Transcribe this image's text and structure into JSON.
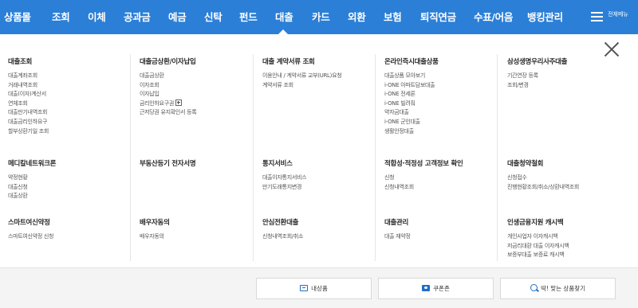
{
  "topnav": {
    "items": [
      "상품몰",
      "조회",
      "이체",
      "공과금",
      "예금",
      "신탁",
      "펀드",
      "대출",
      "카드",
      "외환",
      "보험",
      "퇴직연금",
      "수표/어음",
      "뱅킹관리"
    ],
    "active_index": 7,
    "menu_label": "전체메뉴",
    "color": "#2b7fd7"
  },
  "sections": [
    {
      "title": "대출조회",
      "items": [
        "대출계좌조회",
        "거래내역조회",
        "대출(이자)계산서",
        "연체조회",
        "대출만기내역조회",
        "대출금리인하요구",
        "할부상환기일 조회"
      ]
    },
    {
      "title": "대출금상환/이자납입",
      "items": [
        "대출금상환",
        "이자조회",
        "이자납입",
        "금리인하요구권",
        "근저당권 유지확인서 등록"
      ]
    },
    {
      "title": "대출 계약서류 조회",
      "items": [
        "이용안내 / 계약서류 교부(URL)요청",
        "계약서류 조회"
      ]
    },
    {
      "title": "온라인즉시대출상품",
      "items": [
        "대출상품 모아보기",
        "i-ONE 아파트담보대출",
        "i-ONE 전세론",
        "i-ONE 빌려줘",
        "약자금대출",
        "i-ONE 군인대출",
        "생활안정대출"
      ]
    },
    {
      "title": "삼성생명우리사주대출",
      "items": [
        "기간연장 등록",
        "조회/변경"
      ]
    },
    {
      "title": "메디칼네트워크론",
      "items": [
        "약정현황",
        "대출신청",
        "대출상환"
      ]
    },
    {
      "title": "부동산등기 전자서명",
      "items": []
    },
    {
      "title": "통지서비스",
      "items": [
        "대출이자통지서비스",
        "만기도래통지변경"
      ]
    },
    {
      "title": "적합성·적정성 고객정보 확인",
      "items": [
        "신청",
        "신청내역조회"
      ]
    },
    {
      "title": "대출청약철회",
      "items": [
        "신청접수",
        "진행현황조회/취소/상환내역조회"
      ]
    },
    {
      "title": "스마트여신약정",
      "items": [
        "스마트여신약정 신청"
      ]
    },
    {
      "title": "배우자동의",
      "items": [
        "배우자동의"
      ]
    },
    {
      "title": "안심전환대출",
      "items": [
        "신청내역조회/취소"
      ]
    },
    {
      "title": "대출관리",
      "items": [
        "대출 재약정"
      ]
    },
    {
      "title": "인생금융지원 캐시백",
      "items": [
        "개인사업자 이자캐시백",
        "저금리대환 대출 이자캐시백",
        "보증부대출 보증료 캐시백"
      ]
    }
  ],
  "bottom_buttons": [
    {
      "label": "내상품",
      "icon": "box-icon"
    },
    {
      "label": "쿠폰존",
      "icon": "coupon-icon"
    },
    {
      "label": "딱! 맞는 상품찾기",
      "icon": "search-icon"
    }
  ]
}
